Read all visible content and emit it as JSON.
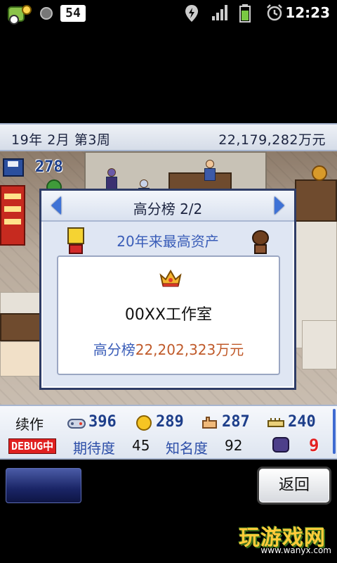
{
  "status_bar": {
    "badge": "54",
    "clock": "12:23",
    "icons": [
      "app-notification-icon",
      "circle-indicator-icon",
      "badge-icon",
      "gps-icon",
      "signal-icon",
      "battery-icon",
      "alarm-icon"
    ]
  },
  "header": {
    "date": "19年  2月  第3周",
    "money": "22,179,282万元"
  },
  "scene": {
    "save_count": "278"
  },
  "dialog": {
    "title": "高分榜  2/2",
    "subtitle": "20年来最高资产",
    "company_name": "00XX工作室",
    "score_label": "高分榜",
    "score_value": "22,202,323万元"
  },
  "info_panel": {
    "sequel_label": "续作",
    "stats": [
      {
        "icon": "controller-icon",
        "value": "396"
      },
      {
        "icon": "coin-icon",
        "value": "289"
      },
      {
        "icon": "hand-icon",
        "value": "287"
      },
      {
        "icon": "research-icon",
        "value": "240"
      }
    ],
    "debug_label": "DEBUG中",
    "expectation_label": "期待度",
    "expectation_value": "45",
    "fame_label": "知名度",
    "fame_value": "92",
    "red_number": "9"
  },
  "bottom": {
    "back_label": "返回"
  },
  "watermark": {
    "text": "玩游戏网",
    "url": "www.wanyx.com"
  },
  "colors": {
    "accent_blue": "#3a5db8",
    "score_orange": "#c05a2a",
    "debug_red": "#e02020"
  }
}
